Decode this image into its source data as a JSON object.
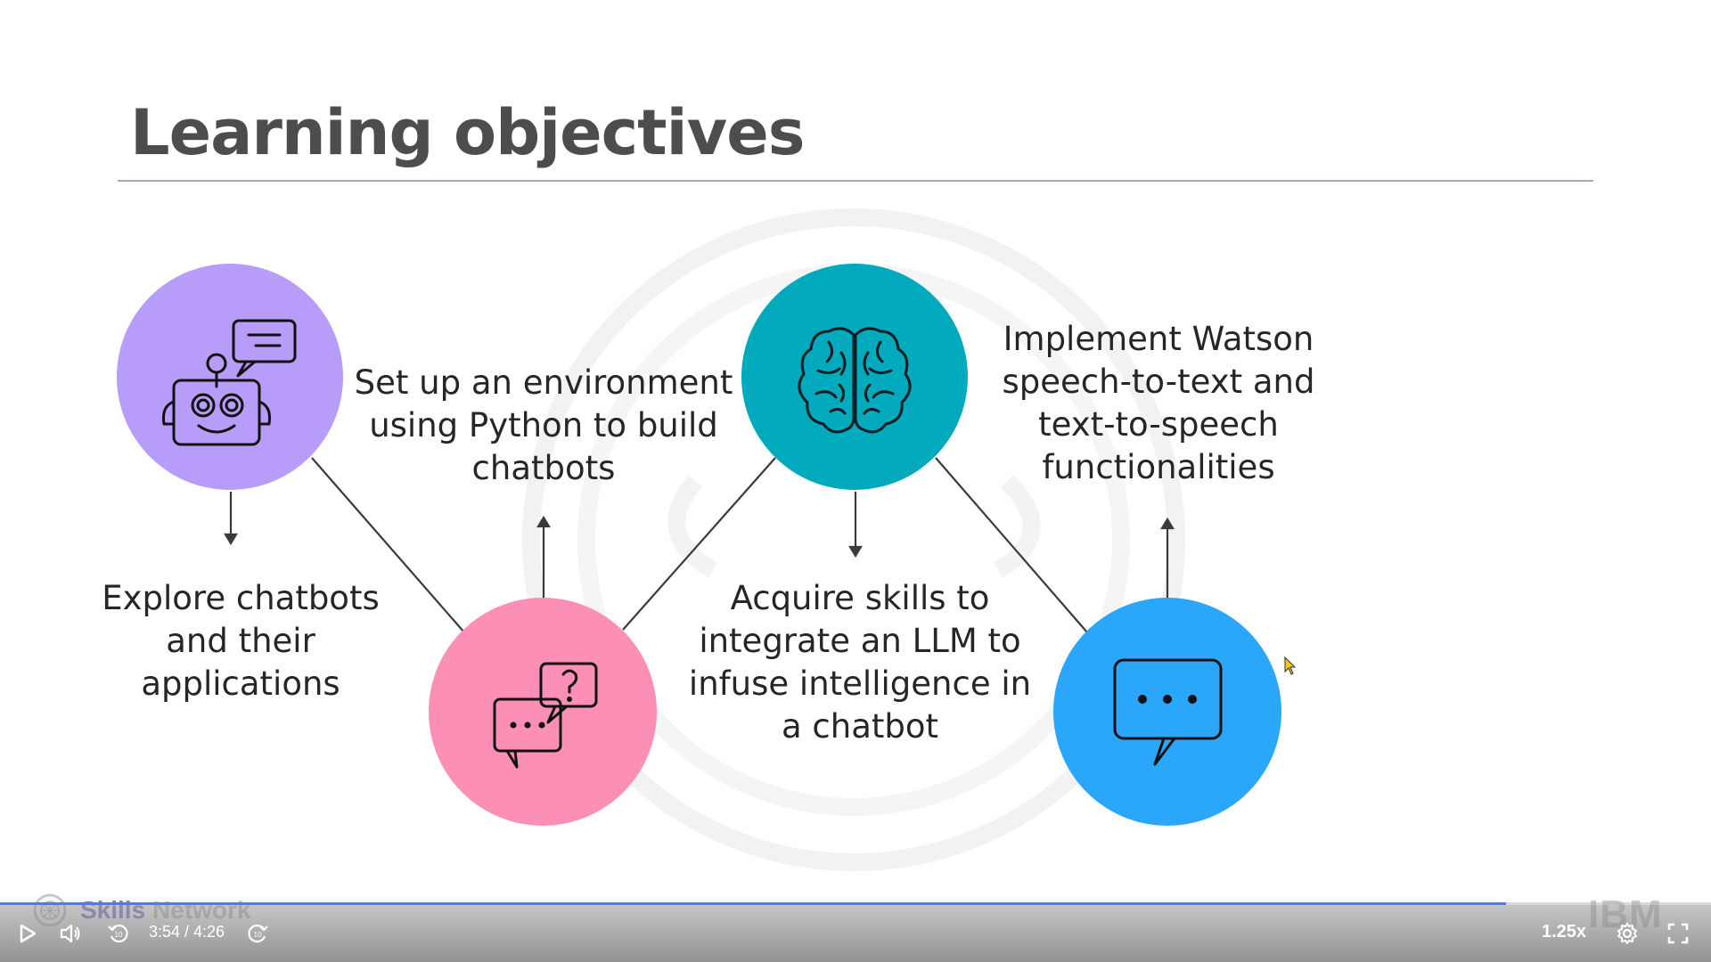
{
  "slide": {
    "title": "Learning objectives",
    "objectives": [
      {
        "text": "Explore chatbots and their applications",
        "icon": "robot-icon",
        "color": "#b79cfa"
      },
      {
        "text": "Set up an environment using Python to build chatbots",
        "icon": "chat-question-icon",
        "color": "#fb8fb6"
      },
      {
        "text": "Acquire skills to integrate an LLM to infuse intelligence in a chatbot",
        "icon": "brain-icon",
        "color": "#00aabd"
      },
      {
        "text": "Implement Watson speech-to-text and text-to-speech functionalities",
        "icon": "chat-bubble-icon",
        "color": "#2aa6fb"
      }
    ],
    "watermark": {
      "brand_part1": "Skills",
      "brand_part2": "Network",
      "logo_text": "IBM"
    }
  },
  "player": {
    "current_time": "3:54",
    "duration": "4:26",
    "time_display": "3:54 / 4:26",
    "progress_fraction": 0.88,
    "playback_speed": "1.25x",
    "icons": [
      "play-icon",
      "volume-icon",
      "rewind-10-icon",
      "forward-10-icon",
      "settings-gear-icon",
      "fullscreen-icon"
    ],
    "accent_color": "#3b82f6"
  }
}
